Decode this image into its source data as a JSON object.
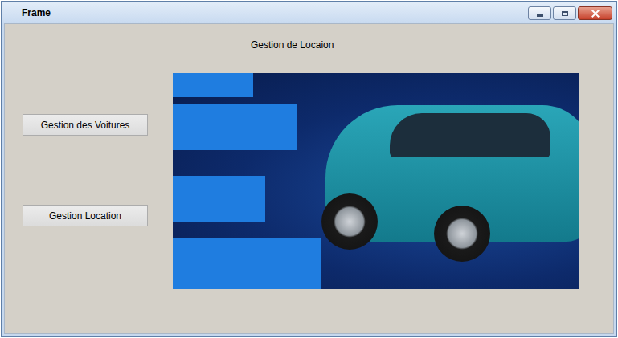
{
  "window": {
    "title": "Frame"
  },
  "heading": "Gestion de Locaion",
  "buttons": [
    "Gestion des Voitures",
    "Gestion Location"
  ]
}
